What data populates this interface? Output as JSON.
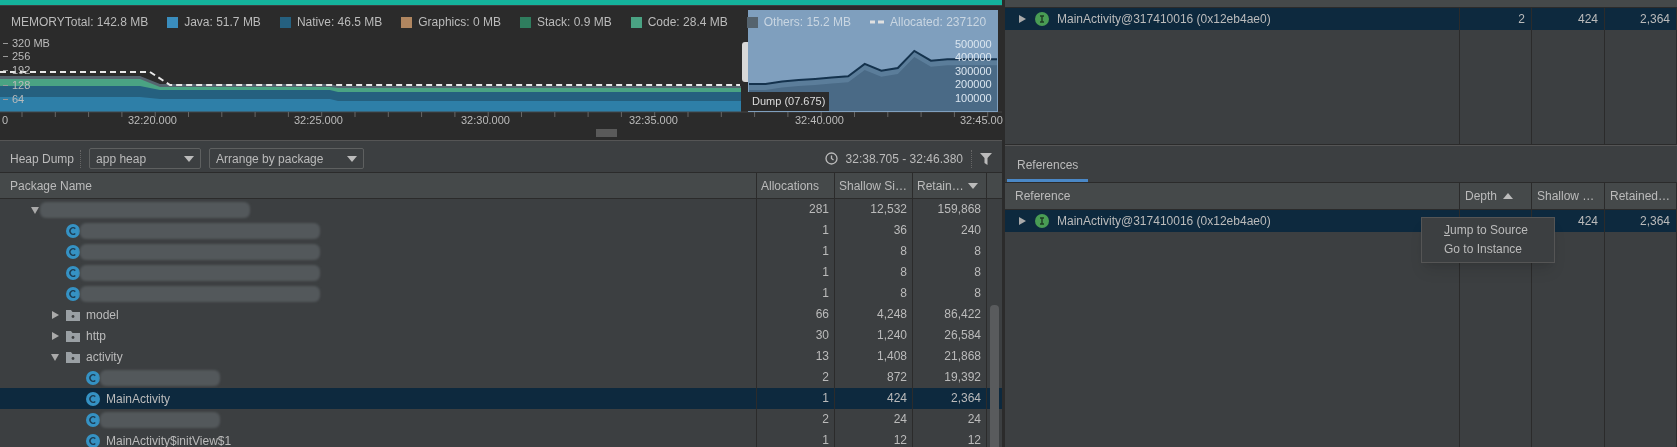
{
  "memory": {
    "title": "MEMORYTotal: 142.8 MB",
    "legend": [
      {
        "kind": "swatch",
        "label": "Java: 51.7 MB",
        "color": "#3a8dbd"
      },
      {
        "kind": "swatch",
        "label": "Native: 46.5 MB",
        "color": "#25607f"
      },
      {
        "kind": "swatch",
        "label": "Graphics: 0 MB",
        "color": "#b08660"
      },
      {
        "kind": "swatch",
        "label": "Stack: 0.9 MB",
        "color": "#2f7d5e"
      },
      {
        "kind": "swatch",
        "label": "Code: 28.4 MB",
        "color": "#4aa383"
      },
      {
        "kind": "swatch",
        "label": "Others: 15.2 MB",
        "color": "#55636e"
      },
      {
        "kind": "dashed",
        "label": "Allocated: 237120",
        "color": "#e0e0e0"
      }
    ],
    "y_labels": [
      "320 MB",
      "256",
      "192",
      "128",
      "64"
    ],
    "time_labels": [
      "0",
      "32:20.000",
      "32:25.000",
      "32:30.000",
      "32:35.000",
      "32:40.000",
      "32:45.00"
    ],
    "dump_label": "Dump (07.675)",
    "chart_data": {
      "type": "line",
      "categories": [
        null,
        null,
        null,
        null,
        null,
        null,
        null,
        null,
        null,
        null,
        null,
        null,
        null,
        null,
        null,
        null
      ],
      "series": [
        {
          "color": "#14324d",
          "values": [
            207000,
            207000,
            225000,
            236000,
            245000,
            255000,
            265000,
            356000,
            306000,
            326000,
            452000,
            380000,
            390000,
            390000,
            390000,
            390000
          ]
        }
      ],
      "ylim": [
        0,
        755000
      ],
      "yticks": [
        {
          "value": 500000,
          "label": "500000"
        },
        {
          "value": 400000,
          "label": "400000"
        },
        {
          "value": 300000,
          "label": "300000"
        },
        {
          "value": 200000,
          "label": "200000"
        },
        {
          "value": 100000,
          "label": "100000"
        }
      ]
    }
  },
  "toolbar": {
    "title": "Heap Dump",
    "heap_select": "app heap",
    "arrange_select": "Arrange by package",
    "time_range": "32:38.705 - 32:46.380"
  },
  "class_table": {
    "columns": [
      {
        "label": "Package Name",
        "sorted": false
      },
      {
        "label": "Allocations",
        "sorted": false
      },
      {
        "label": "Shallow Si…",
        "sorted": false
      },
      {
        "label": "Retain…",
        "sorted": true,
        "descending": true
      }
    ],
    "rows": [
      {
        "kind": "package",
        "redacted": true,
        "expanded": true,
        "selected": false,
        "allocations": "281",
        "shallow": "12,532",
        "retained": "159,868",
        "children": [
          {
            "kind": "class",
            "redacted": true,
            "selected": false,
            "allocations": "1",
            "shallow": "36",
            "retained": "240"
          },
          {
            "kind": "class",
            "redacted": true,
            "selected": false,
            "allocations": "1",
            "shallow": "8",
            "retained": "8"
          },
          {
            "kind": "class",
            "redacted": true,
            "selected": false,
            "allocations": "1",
            "shallow": "8",
            "retained": "8"
          },
          {
            "kind": "class",
            "redacted": true,
            "selected": false,
            "allocations": "1",
            "shallow": "8",
            "retained": "8"
          },
          {
            "kind": "package",
            "name": "model",
            "expanded": false,
            "selected": false,
            "allocations": "66",
            "shallow": "4,248",
            "retained": "86,422"
          },
          {
            "kind": "package",
            "name": "http",
            "expanded": false,
            "selected": false,
            "allocations": "30",
            "shallow": "1,240",
            "retained": "26,584"
          },
          {
            "kind": "package",
            "name": "activity",
            "expanded": true,
            "selected": false,
            "allocations": "13",
            "shallow": "1,408",
            "retained": "21,868",
            "children": [
              {
                "kind": "class",
                "redacted": true,
                "selected": false,
                "allocations": "2",
                "shallow": "872",
                "retained": "19,392"
              },
              {
                "kind": "class",
                "name": "MainActivity",
                "selected": true,
                "allocations": "1",
                "shallow": "424",
                "retained": "2,364"
              },
              {
                "kind": "class",
                "redacted": true,
                "selected": false,
                "allocations": "2",
                "shallow": "24",
                "retained": "24"
              },
              {
                "kind": "class",
                "name": "MainActivity$initView$1",
                "selected": false,
                "allocations": "1",
                "shallow": "12",
                "retained": "12"
              }
            ]
          }
        ]
      }
    ]
  },
  "instances": {
    "rows": [
      {
        "name": "MainActivity@317410016 (0x12eb4ae0)",
        "expanded": false,
        "selected": true,
        "depth": "2",
        "shallow": "424",
        "retained": "2,364"
      }
    ]
  },
  "tabs": [
    {
      "label": "References",
      "selected": true
    }
  ],
  "references": {
    "columns": [
      {
        "label": "Reference",
        "sorted": false
      },
      {
        "label": "Depth",
        "sorted": true,
        "descending": false
      },
      {
        "label": "Shallow …",
        "sorted": false
      },
      {
        "label": "Retained…",
        "sorted": false
      }
    ],
    "rows": [
      {
        "name": "MainActivity@317410016 (0x12eb4ae0)",
        "expanded": false,
        "selected": true,
        "shallow": "424",
        "retained": "2,364"
      }
    ]
  },
  "context_menu": {
    "items": [
      {
        "label": "Jump to Source",
        "underline_first": true
      },
      {
        "label": "Go to Instance",
        "underline_first": false
      }
    ]
  }
}
